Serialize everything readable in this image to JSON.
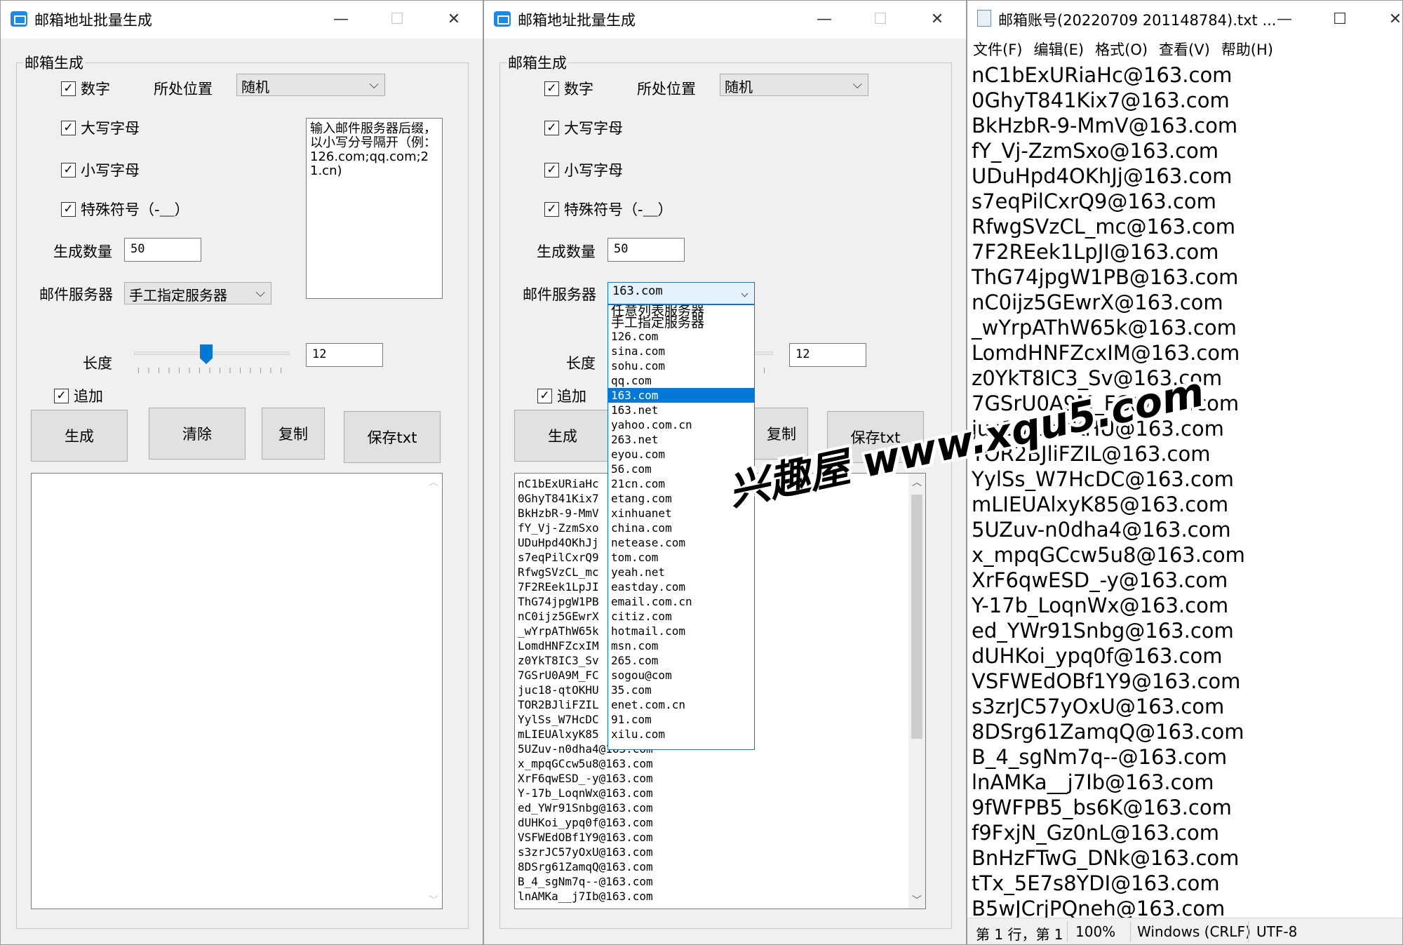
{
  "window1": {
    "title": "邮箱地址批量生成",
    "group_label": "邮箱生成",
    "cb_digits": "数字",
    "cb_upper": "大写字母",
    "cb_lower": "小写字母",
    "cb_special": "特殊符号（-＿）",
    "position_label": "所处位置",
    "position_value": "随机",
    "hint_text": "输入邮件服务器后缀，以小写分号隔开（例：126.com;qq.com;21.cn)",
    "count_label": "生成数量",
    "count_value": "50",
    "server_label": "邮件服务器",
    "server_value": "手工指定服务器",
    "length_label": "长度",
    "length_value": "12",
    "length_slider_fraction": 0.5,
    "append_label": "追加",
    "btn_generate": "生成",
    "btn_clear": "清除",
    "btn_copy": "复制",
    "btn_save": "保存txt",
    "output": ""
  },
  "window2": {
    "title": "邮箱地址批量生成",
    "group_label": "邮箱生成",
    "cb_digits": "数字",
    "cb_upper": "大写字母",
    "cb_lower": "小写字母",
    "cb_special": "特殊符号（-＿）",
    "position_label": "所处位置",
    "position_value": "随机",
    "count_label": "生成数量",
    "count_value": "50",
    "server_label": "邮件服务器",
    "server_value": "163.com",
    "length_label": "长度",
    "length_value": "12",
    "append_label": "追加",
    "btn_generate": "生成",
    "btn_copy": "复制",
    "btn_save": "保存txt",
    "dropdown_options": [
      "任意列表服务器",
      "手工指定服务器",
      "126.com",
      "sina.com",
      "sohu.com",
      "qq.com",
      "163.com",
      "163.net",
      "yahoo.com.cn",
      "263.net",
      "eyou.com",
      "56.com",
      "21cn.com",
      "etang.com",
      "xinhuanet",
      "china.com",
      "netease.com",
      "tom.com",
      "yeah.net",
      "eastday.com",
      "email.com.cn",
      "citiz.com",
      "hotmail.com",
      "msn.com",
      "265.com",
      "sogou@com",
      "35.com",
      "enet.com.cn",
      "91.com",
      "xilu.com"
    ],
    "dropdown_selected": "163.com",
    "output_lines": [
      "nC1bExURiaHc",
      "0GhyT841Kix7",
      "BkHzbR-9-MmV",
      "fY_Vj-ZzmSxo",
      "UDuHpd4OKhJj",
      "s7eqPilCxrQ9",
      "RfwgSVzCL_mc",
      "7F2REek1LpJI",
      "ThG74jpgW1PB",
      "nC0ijz5GEwrX",
      "_wYrpAThW65k",
      "LomdHNFZcxIM",
      "z0YkT8IC3_Sv",
      "7GSrU0A9M_FC",
      "juc18-qtOKHU",
      "TOR2BJliFZIL",
      "YylSs_W7HcDC",
      "mLIEUAlxyK85",
      "5UZuv-n0dha4@163.com",
      "x_mpqGCcw5u8@163.com",
      "XrF6qwESD_-y@163.com",
      "Y-17b_LoqnWx@163.com",
      "ed_YWr91Snbg@163.com",
      "dUHKoi_ypq0f@163.com",
      "VSFWEdOBf1Y9@163.com",
      "s3zrJC57yOxU@163.com",
      "8DSrg61ZamqQ@163.com",
      "B_4_sgNm7q--@163.com",
      "lnAMKa__j7Ib@163.com"
    ]
  },
  "notepad": {
    "title": "邮箱账号(20220709 201148784).txt ...",
    "menu": [
      "文件(F)",
      "编辑(E)",
      "格式(O)",
      "查看(V)",
      "帮助(H)"
    ],
    "lines": [
      "nC1bExURiaHc@163.com",
      "0GhyT841Kix7@163.com",
      "BkHzbR-9-MmV@163.com",
      "fY_Vj-ZzmSxo@163.com",
      "UDuHpd4OKhJj@163.com",
      "s7eqPilCxrQ9@163.com",
      "RfwgSVzCL_mc@163.com",
      "7F2REek1LpJI@163.com",
      "ThG74jpgW1PB@163.com",
      "nC0ijz5GEwrX@163.com",
      "_wYrpAThW65k@163.com",
      "LomdHNFZcxIM@163.com",
      "z0YkT8IC3_Sv@163.com",
      "7GSrU0A9M_FC@163.com",
      "juc18-qtOKHU@163.com",
      "TOR2BJliFZIL@163.com",
      "YylSs_W7HcDC@163.com",
      "mLIEUAlxyK85@163.com",
      "5UZuv-n0dha4@163.com",
      "x_mpqGCcw5u8@163.com",
      "XrF6qwESD_-y@163.com",
      "Y-17b_LoqnWx@163.com",
      "ed_YWr91Snbg@163.com",
      "dUHKoi_ypq0f@163.com",
      "VSFWEdOBf1Y9@163.com",
      "s3zrJC57yOxU@163.com",
      "8DSrg61ZamqQ@163.com",
      "B_4_sgNm7q--@163.com",
      "lnAMKa__j7Ib@163.com",
      "9fWFPB5_bs6K@163.com",
      "f9FxjN_Gz0nL@163.com",
      "BnHzFTwG_DNk@163.com",
      "tTx_5E7s8YDI@163.com",
      "B5wJCrjPQneh@163.com"
    ],
    "status_pos": "第 1 行，第 1",
    "status_zoom": "100%",
    "status_eol": "Windows (CRLF)",
    "status_enc": "UTF-8"
  },
  "watermark": "兴趣屋 www.xqu5.com",
  "icons": {
    "minimize": "minimize-icon",
    "maximize": "maximize-icon",
    "close": "close-icon",
    "check": "check-icon",
    "dropdown": "chevron-down-icon"
  },
  "colors": {
    "accent": "#0078d7",
    "window_bg": "#f0f0f0",
    "app_icon": "#1e88e5"
  }
}
